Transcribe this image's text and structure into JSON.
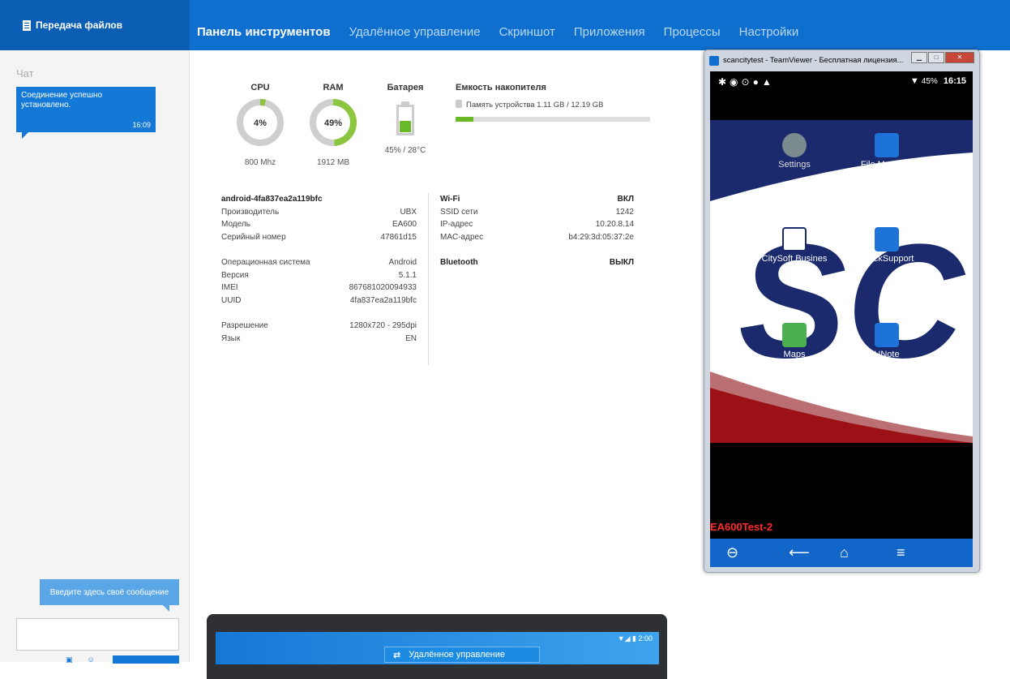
{
  "header": {
    "file_transfer": "Передача файлов",
    "tabs": [
      "Панель инструментов",
      "Удалённое управление",
      "Скриншот",
      "Приложения",
      "Процессы",
      "Настройки"
    ]
  },
  "chat": {
    "title": "Чат",
    "message": "Соединение успешно установлено.",
    "time": "16:09",
    "input_hint": "Введите здесь своё сообщение",
    "input_value": ""
  },
  "gauges": {
    "cpu": {
      "label": "CPU",
      "value": "4%",
      "percent": 4,
      "sub": "800 Mhz",
      "color": "#8cc63f"
    },
    "ram": {
      "label": "RAM",
      "value": "49%",
      "percent": 49,
      "sub": "1912 MB",
      "color": "#8cc63f"
    },
    "battery": {
      "label": "Батарея",
      "percent": 45,
      "sub": "45% / 28°C",
      "color": "#68b828"
    }
  },
  "storage": {
    "title": "Емкость накопителя",
    "line": "Память устройства 1.11 GB / 12.19 GB",
    "fill_fraction": 0.091
  },
  "device": {
    "name": "android-4fa837ea2a119bfc",
    "rows": [
      {
        "k": "Производитель",
        "v": "UBX"
      },
      {
        "k": "Модель",
        "v": "EA600"
      },
      {
        "k": "Серийный номер",
        "v": "47861d15"
      }
    ],
    "os_rows": [
      {
        "k": "Операционная система",
        "v": "Android"
      },
      {
        "k": "Версия",
        "v": "5.1.1"
      },
      {
        "k": "IMEI",
        "v": "867681020094933"
      },
      {
        "k": "UUID",
        "v": "4fa837ea2a119bfc"
      }
    ],
    "disp_rows": [
      {
        "k": "Разрешение",
        "v": "1280x720 - 295dpi"
      },
      {
        "k": "Язык",
        "v": "EN"
      }
    ]
  },
  "network": {
    "wifi": {
      "k": "Wi-Fi",
      "v": "ВКЛ"
    },
    "rows": [
      {
        "k": "SSID сети",
        "v": "1242"
      },
      {
        "k": "IP-адрес",
        "v": "10.20.8.14"
      },
      {
        "k": "MAC-адрес",
        "v": "b4:29:3d:05:37:2e"
      }
    ],
    "bluetooth": {
      "k": "Bluetooth",
      "v": "ВЫКЛ"
    }
  },
  "teamviewer": {
    "title": "scancitytest - TeamViewer - Бесплатная лицензия...",
    "status_battery": "45%",
    "status_time": "16:15",
    "apps": [
      "Settings",
      "File Manager",
      "CitySoft Busines",
      "QuickSupport",
      "Maps",
      "UNote"
    ],
    "device_label": "EA600Test-2"
  },
  "laptop": {
    "status": "▼◢ ▮ 2:00",
    "remote_label": "Удалённое управление"
  }
}
